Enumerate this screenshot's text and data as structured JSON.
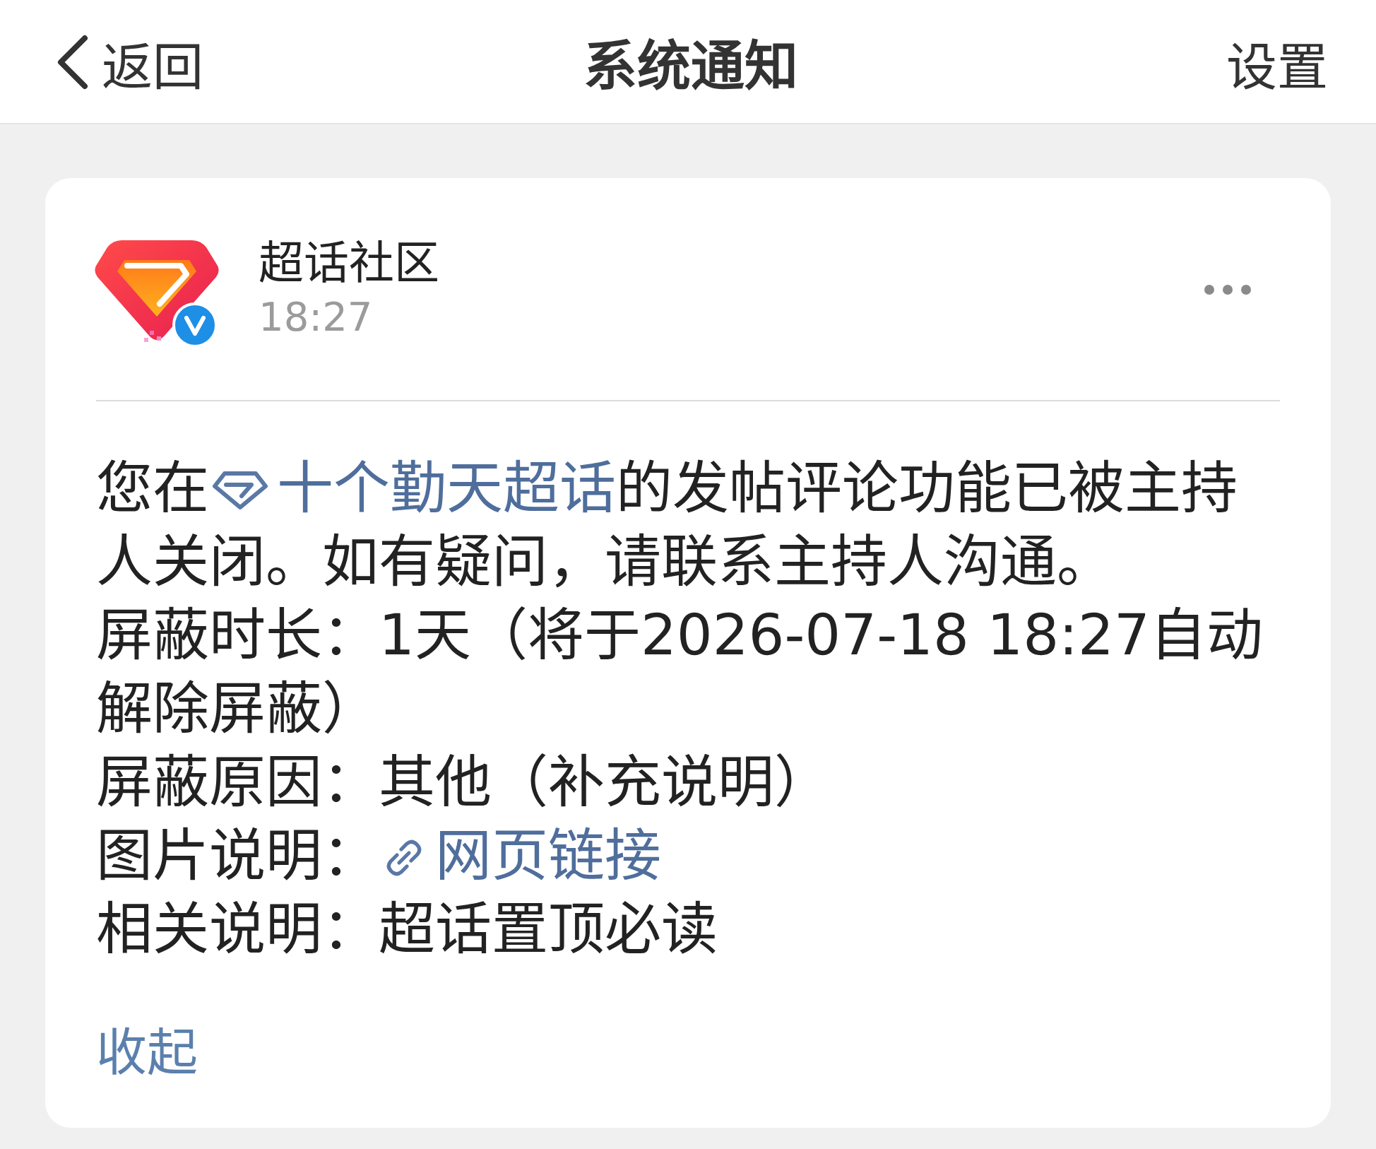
{
  "header": {
    "back": "返回",
    "title": "系统通知",
    "settings": "设置"
  },
  "notification": {
    "sender": "超话社区",
    "verified": true,
    "time": "18:27",
    "message": {
      "before": "您在",
      "topic": "十个勤天超话",
      "after": "的发帖评论功能已被主持人关闭。如有疑问，请联系主持人沟通。"
    },
    "details": [
      {
        "kind": "text",
        "label": "屏蔽时长：",
        "value": "1天（将于2026-07-18 18:27自动解除屏蔽）"
      },
      {
        "kind": "text",
        "label": "屏蔽原因：",
        "value": "其他（补充说明）"
      },
      {
        "kind": "link",
        "label": "图片说明：",
        "value": "网页链接"
      },
      {
        "kind": "text",
        "label": "相关说明：",
        "value": "超话置顶必读"
      }
    ],
    "collapse": "收起"
  }
}
